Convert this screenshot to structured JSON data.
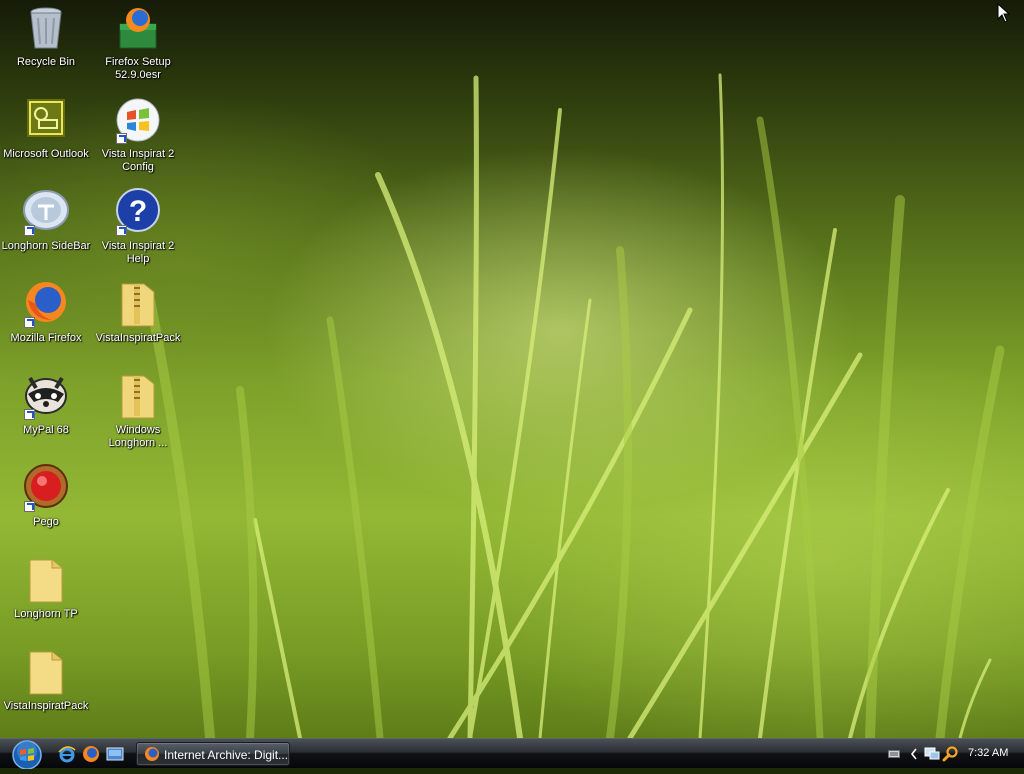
{
  "desktop": {
    "icons": [
      {
        "label": "Recycle Bin",
        "icon": "recycle-bin-icon"
      },
      {
        "label": "Firefox Setup 52.9.0esr",
        "icon": "firefox-setup-icon"
      },
      {
        "label": "Microsoft Outlook",
        "icon": "outlook-icon"
      },
      {
        "label": "Vista Inspirat 2 Config",
        "icon": "windows-logo-icon"
      },
      {
        "label": "Longhorn SideBar",
        "icon": "sidebar-icon"
      },
      {
        "label": "Vista Inspirat 2 Help",
        "icon": "help-icon"
      },
      {
        "label": "Mozilla Firefox",
        "icon": "firefox-icon"
      },
      {
        "label": "VistaInspiratPack",
        "icon": "zip-folder-icon"
      },
      {
        "label": "MyPal 68",
        "icon": "mypal-icon"
      },
      {
        "label": "Windows Longhorn ...",
        "icon": "zip-folder-icon"
      },
      {
        "label": "Pego",
        "icon": "pego-icon"
      },
      {
        "label": "Longhorn TP",
        "icon": "folder-icon"
      },
      {
        "label": "VistaInspiratPack",
        "icon": "folder-icon"
      }
    ]
  },
  "taskbar": {
    "start": "start-orb-icon",
    "quick_launch": [
      "internet-explorer-icon",
      "firefox-icon",
      "show-desktop-icon"
    ],
    "tasks": [
      {
        "label": "Internet Archive: Digit...",
        "icon": "firefox-icon"
      }
    ],
    "tray": [
      "keyboard-icon",
      "chevron-left-icon",
      "network-icon",
      "search-icon"
    ],
    "clock": "7:32 AM"
  }
}
